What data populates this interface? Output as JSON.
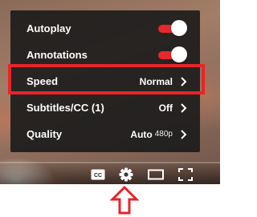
{
  "settings_menu": {
    "items": [
      {
        "label": "Autoplay",
        "type": "toggle",
        "on": true
      },
      {
        "label": "Annotations",
        "type": "toggle",
        "on": true
      },
      {
        "label": "Speed",
        "type": "option",
        "value": "Normal",
        "highlighted": true
      },
      {
        "label": "Subtitles/CC",
        "count": "(1)",
        "type": "option",
        "value": "Off"
      },
      {
        "label": "Quality",
        "type": "option",
        "value": "Auto",
        "value_sub": "480p"
      }
    ]
  },
  "player_controls": {
    "icons": [
      "subtitles-cc-icon",
      "gear-icon",
      "theater-mode-icon",
      "fullscreen-icon"
    ],
    "cc_label": "CC"
  },
  "colors": {
    "toggle_on": "#e8282b",
    "highlight_box": "#e8242a",
    "menu_background": "#1c1c1c",
    "arrow_outline": "#e8242a"
  }
}
